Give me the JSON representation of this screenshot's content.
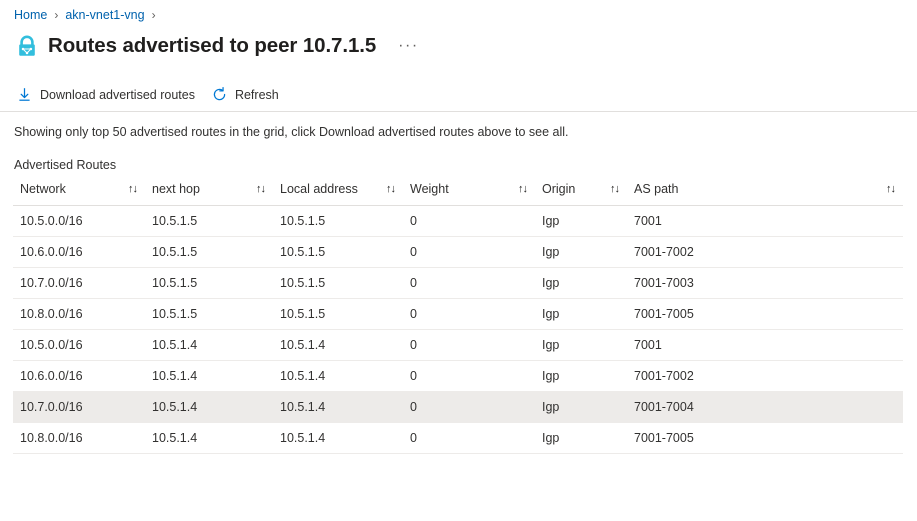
{
  "breadcrumb": {
    "items": [
      {
        "label": "Home"
      },
      {
        "label": "akn-vnet1-vng"
      }
    ],
    "separator": "›"
  },
  "header": {
    "icon": "vpn-gateway-lock-icon",
    "title": "Routes advertised to peer 10.7.1.5",
    "more_menu": "···"
  },
  "toolbar": {
    "download_label": "Download advertised routes",
    "download_icon": "download-icon",
    "refresh_label": "Refresh",
    "refresh_icon": "refresh-icon"
  },
  "info": {
    "message": "Showing only top 50 advertised routes in the grid, click Download advertised routes above to see all."
  },
  "section": {
    "label": "Advertised Routes"
  },
  "table": {
    "sort_glyph": "↑↓",
    "columns": [
      {
        "key": "network",
        "label": "Network",
        "sortable": true
      },
      {
        "key": "next_hop",
        "label": "next hop",
        "sortable": true
      },
      {
        "key": "local_address",
        "label": "Local address",
        "sortable": true
      },
      {
        "key": "weight",
        "label": "Weight",
        "sortable": true
      },
      {
        "key": "origin",
        "label": "Origin",
        "sortable": true
      },
      {
        "key": "as_path",
        "label": "AS path",
        "sortable": true
      }
    ],
    "rows": [
      {
        "network": "10.5.0.0/16",
        "next_hop": "10.5.1.5",
        "local_address": "10.5.1.5",
        "weight": "0",
        "origin": "Igp",
        "as_path": "7001",
        "selected": false
      },
      {
        "network": "10.6.0.0/16",
        "next_hop": "10.5.1.5",
        "local_address": "10.5.1.5",
        "weight": "0",
        "origin": "Igp",
        "as_path": "7001-7002",
        "selected": false
      },
      {
        "network": "10.7.0.0/16",
        "next_hop": "10.5.1.5",
        "local_address": "10.5.1.5",
        "weight": "0",
        "origin": "Igp",
        "as_path": "7001-7003",
        "selected": false
      },
      {
        "network": "10.8.0.0/16",
        "next_hop": "10.5.1.5",
        "local_address": "10.5.1.5",
        "weight": "0",
        "origin": "Igp",
        "as_path": "7001-7005",
        "selected": false
      },
      {
        "network": "10.5.0.0/16",
        "next_hop": "10.5.1.4",
        "local_address": "10.5.1.4",
        "weight": "0",
        "origin": "Igp",
        "as_path": "7001",
        "selected": false
      },
      {
        "network": "10.6.0.0/16",
        "next_hop": "10.5.1.4",
        "local_address": "10.5.1.4",
        "weight": "0",
        "origin": "Igp",
        "as_path": "7001-7002",
        "selected": false
      },
      {
        "network": "10.7.0.0/16",
        "next_hop": "10.5.1.4",
        "local_address": "10.5.1.4",
        "weight": "0",
        "origin": "Igp",
        "as_path": "7001-7004",
        "selected": true
      },
      {
        "network": "10.8.0.0/16",
        "next_hop": "10.5.1.4",
        "local_address": "10.5.1.4",
        "weight": "0",
        "origin": "Igp",
        "as_path": "7001-7005",
        "selected": false
      }
    ]
  },
  "colors": {
    "link": "#0062ad",
    "accent": "#0078d4",
    "icon_cyan": "#32bedd",
    "text": "#323130",
    "row_selected": "#edebe9",
    "border": "#e1dfdd"
  }
}
